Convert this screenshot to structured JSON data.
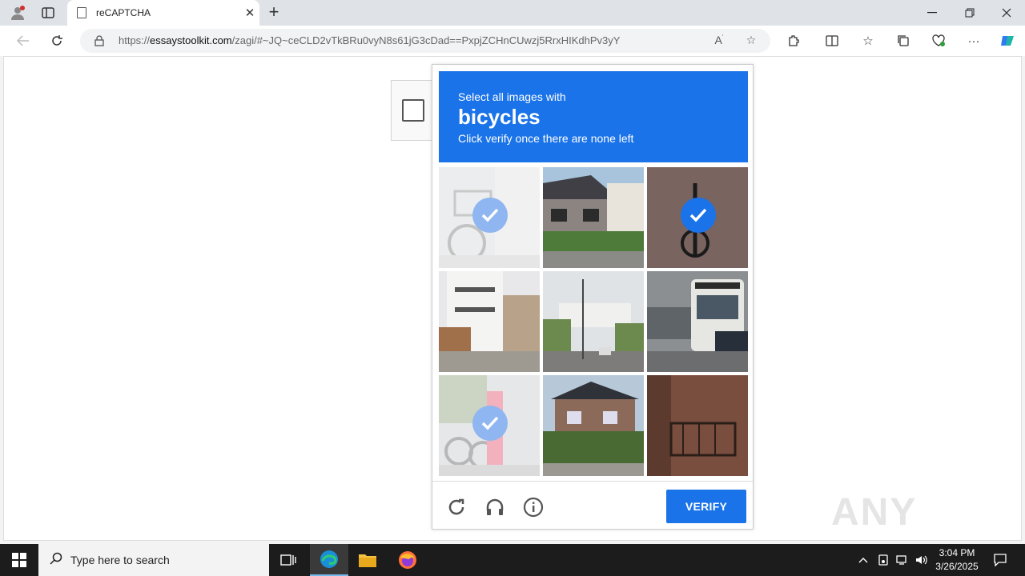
{
  "browser": {
    "tab_title": "reCAPTCHA",
    "new_tab_label": "+",
    "url_prefix": "https://",
    "url_host": "essaystoolkit.com",
    "url_path": "/zagi/#~JQ~ceCLD2vTkBRu0vyN8s61jG3cDad==PxpjZCHnCUwzj5RrxHIKdhPv3yY"
  },
  "captcha": {
    "prompt_line1": "Select all images with",
    "prompt_target": "bicycles",
    "prompt_line3": "Click verify once there are none left",
    "verify_label": "VERIFY",
    "tiles": [
      {
        "desc": "bicycle with basket",
        "selected": true,
        "faded": true
      },
      {
        "desc": "row houses",
        "selected": false,
        "faded": false
      },
      {
        "desc": "bicycle on pavement",
        "selected": true,
        "faded": false
      },
      {
        "desc": "apartment building",
        "selected": false,
        "faded": false
      },
      {
        "desc": "street intersection",
        "selected": false,
        "faded": false
      },
      {
        "desc": "bus in traffic",
        "selected": false,
        "faded": false
      },
      {
        "desc": "parked bicycles",
        "selected": true,
        "faded": true
      },
      {
        "desc": "house with trees",
        "selected": false,
        "faded": false
      },
      {
        "desc": "balcony",
        "selected": false,
        "faded": false
      }
    ]
  },
  "watermark": "ANY RUN",
  "taskbar": {
    "search_placeholder": "Type here to search",
    "time": "3:04 PM",
    "date": "3/26/2025"
  },
  "colors": {
    "accent": "#1a73e8",
    "taskbar": "#1c1c1c"
  }
}
